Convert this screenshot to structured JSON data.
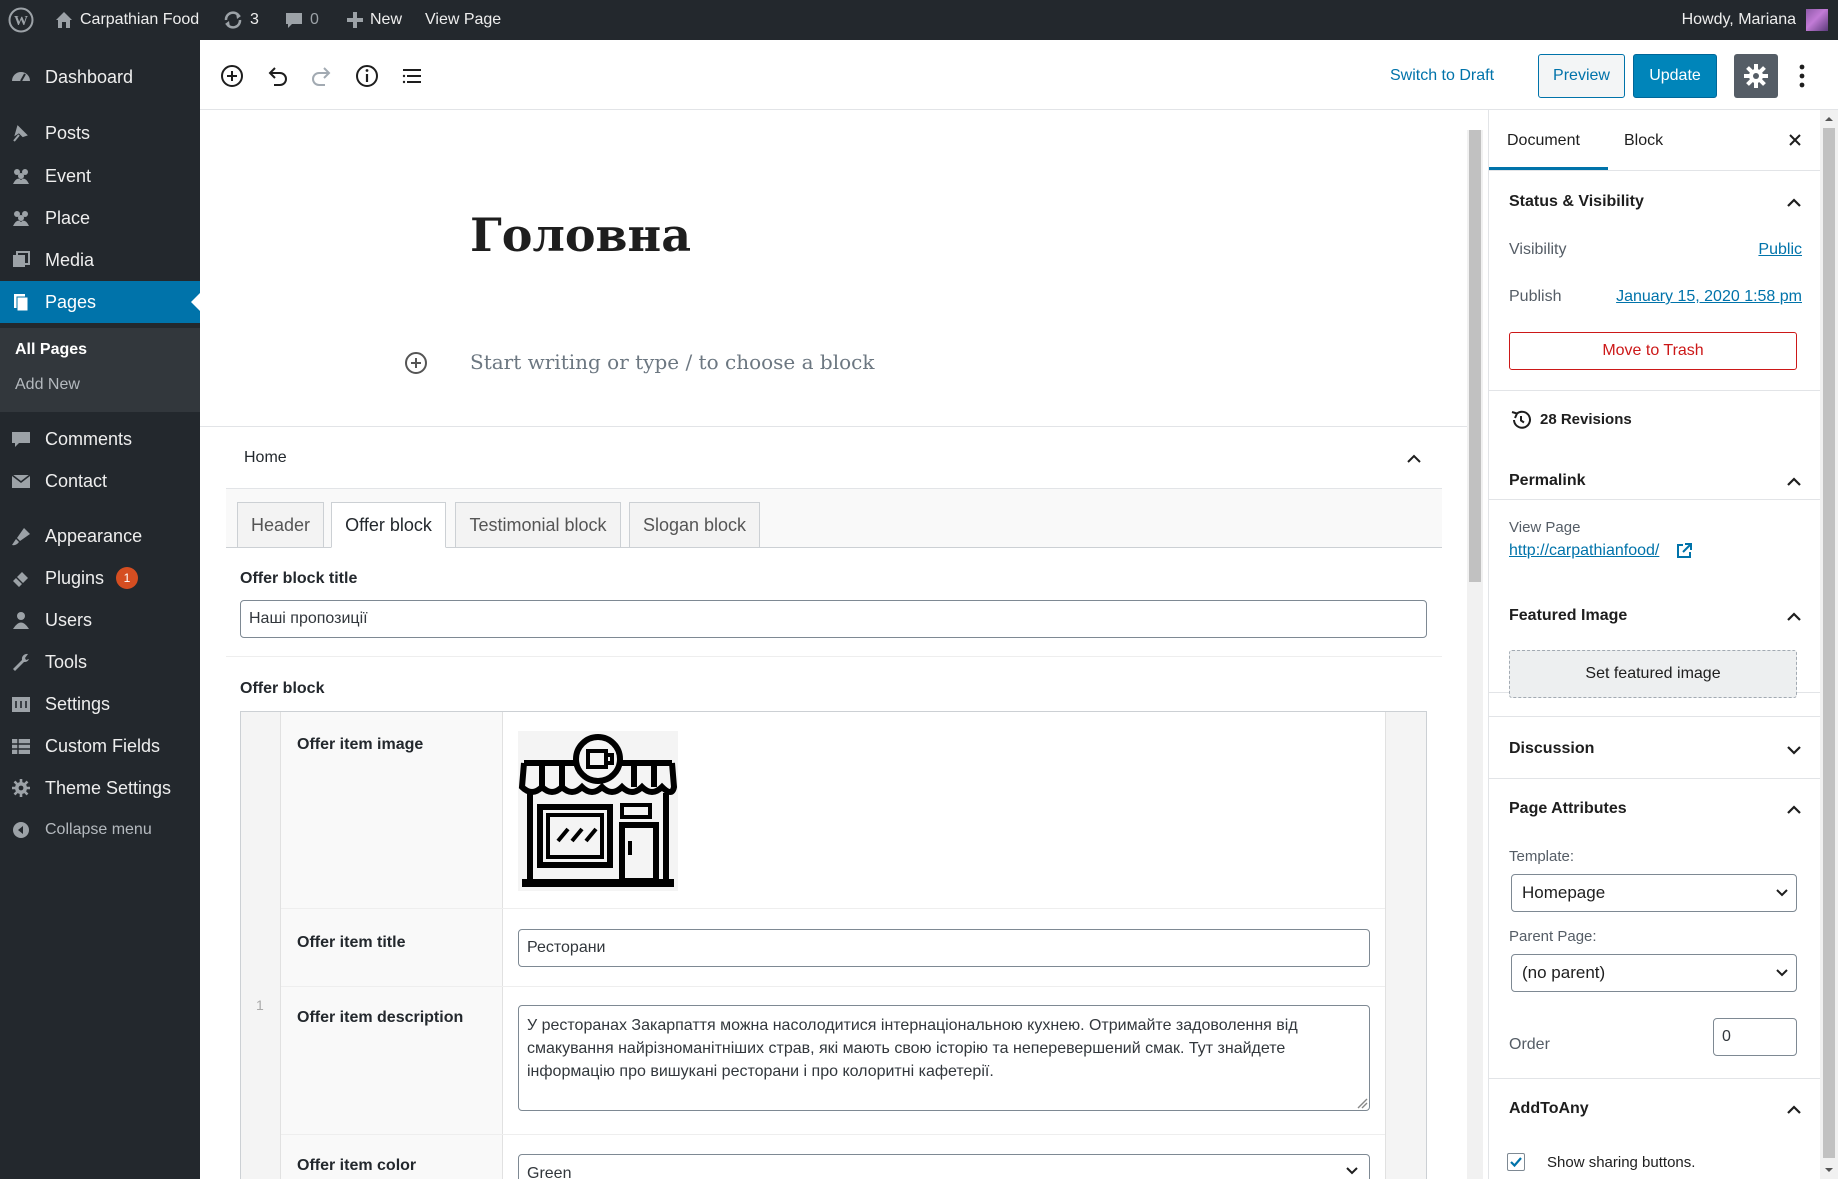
{
  "admin_bar": {
    "site_name": "Carpathian Food",
    "updates_count": "3",
    "comments_count": "0",
    "new_label": "New",
    "view_page_label": "View Page",
    "greeting": "Howdy, Mariana"
  },
  "sidebar": {
    "items": [
      {
        "label": "Dashboard",
        "icon": "dashboard-icon"
      },
      {
        "label": "Posts",
        "icon": "pin-icon"
      },
      {
        "label": "Event",
        "icon": "people-icon"
      },
      {
        "label": "Place",
        "icon": "people-icon"
      },
      {
        "label": "Media",
        "icon": "media-icon"
      },
      {
        "label": "Pages",
        "icon": "pages-icon"
      },
      {
        "label": "Comments",
        "icon": "comment-icon"
      },
      {
        "label": "Contact",
        "icon": "mail-icon"
      },
      {
        "label": "Appearance",
        "icon": "brush-icon"
      },
      {
        "label": "Plugins",
        "icon": "plug-icon",
        "badge": "1"
      },
      {
        "label": "Users",
        "icon": "user-icon"
      },
      {
        "label": "Tools",
        "icon": "wrench-icon"
      },
      {
        "label": "Settings",
        "icon": "settings-icon"
      },
      {
        "label": "Custom Fields",
        "icon": "table-icon"
      },
      {
        "label": "Theme Settings",
        "icon": "gear-icon"
      },
      {
        "label": "Collapse menu",
        "icon": "collapse-icon"
      }
    ],
    "submenu": {
      "all_pages": "All Pages",
      "add_new": "Add New"
    }
  },
  "toolbar": {
    "switch_to_draft": "Switch to Draft",
    "preview": "Preview",
    "update": "Update"
  },
  "editor": {
    "title": "Головна",
    "placeholder": "Start writing or type / to choose a block"
  },
  "acf": {
    "group_title": "Home",
    "tabs": [
      "Header",
      "Offer block",
      "Testimonial block",
      "Slogan block"
    ],
    "offer_block_title_label": "Offer block title",
    "offer_block_title_value": "Наші пропозиції",
    "offer_block_label": "Offer block",
    "row_number": "1",
    "image_label": "Offer item image",
    "title_label": "Offer item title",
    "title_value": "Ресторани",
    "description_label": "Offer item description",
    "description_value": "У ресторанах Закарпаття можна насолодитися інтернаціональною кухнею. Отримайте задоволення від смакування найрізноманітніших страв, які мають свою історію та неперевершений смак. Тут знайдете інформацію про вишукані ресторани і про колоритні кафетерії.",
    "color_label": "Offer item color",
    "color_value": "Green"
  },
  "settings_panel": {
    "tab_document": "Document",
    "tab_block": "Block",
    "status_title": "Status & Visibility",
    "visibility_label": "Visibility",
    "visibility_value": "Public",
    "publish_label": "Publish",
    "publish_value": "January 15, 2020 1:58 pm",
    "trash_label": "Move to Trash",
    "revisions": "28 Revisions",
    "permalink_title": "Permalink",
    "view_page": "View Page",
    "permalink_url": "http://carpathianfood/",
    "featured_title": "Featured Image",
    "set_featured": "Set featured image",
    "discussion_title": "Discussion",
    "attributes_title": "Page Attributes",
    "template_label": "Template:",
    "template_value": "Homepage",
    "parent_label": "Parent Page:",
    "parent_value": "(no parent)",
    "order_label": "Order",
    "order_value": "0",
    "addtoany_title": "AddToAny",
    "show_sharing": "Show sharing buttons."
  },
  "colors": {
    "admin_dark": "#23282d",
    "accent_blue": "#0073aa",
    "update_button": "#0085ba",
    "trash_red": "#cc1818"
  }
}
